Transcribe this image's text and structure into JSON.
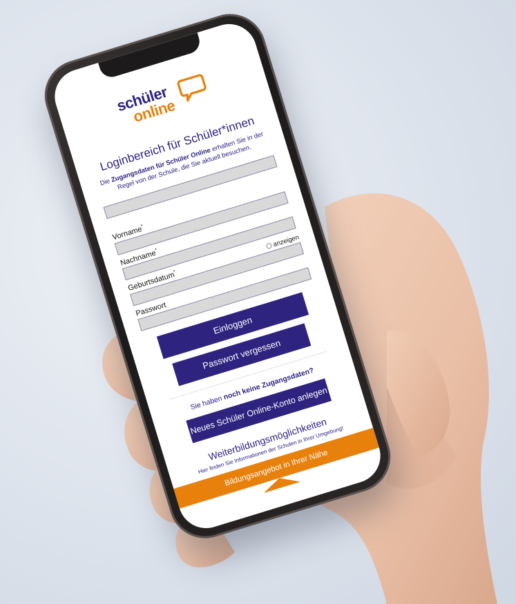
{
  "app": {
    "logo_line1": "schüler",
    "logo_line2": "online"
  },
  "login": {
    "title": "Loginbereich für Schüler*innen",
    "info_prefix": "Die ",
    "info_bold": "Zugangsdaten für Schüler Online",
    "info_suffix": " erhalten Sie in der Regel von der Schule, die Sie aktuell besuchen."
  },
  "form": {
    "firstname_label": "Vorname",
    "lastname_label": "Nachname",
    "birthdate_label": "Geburtsdatum",
    "password_label": "Passwort",
    "required_mark": "*",
    "show_password_label": "anzeigen",
    "firstname_value": "",
    "lastname_value": "",
    "birthdate_value": "",
    "password_value": ""
  },
  "buttons": {
    "login": "Einloggen",
    "forgot_password": "Passwort vergessen",
    "new_account": "Neues Schüler Online-Konto anlegen",
    "nearby_offers": "Bildungsangebot in Ihrer Nähe"
  },
  "no_account": {
    "prefix": "Sie haben ",
    "bold": "noch keine Zugangsdaten?"
  },
  "further_education": {
    "title": "Weiterbildungsmöglichkeiten",
    "info": "Hier finden Sie Informationen der Schulen in Ihrer Umgebung!"
  },
  "icons": {
    "logo_bubble": "speech-bubble-icon",
    "scroll_up": "chevron-up-icon"
  },
  "colors": {
    "brand_blue": "#2e237f",
    "brand_orange": "#e8800c"
  }
}
